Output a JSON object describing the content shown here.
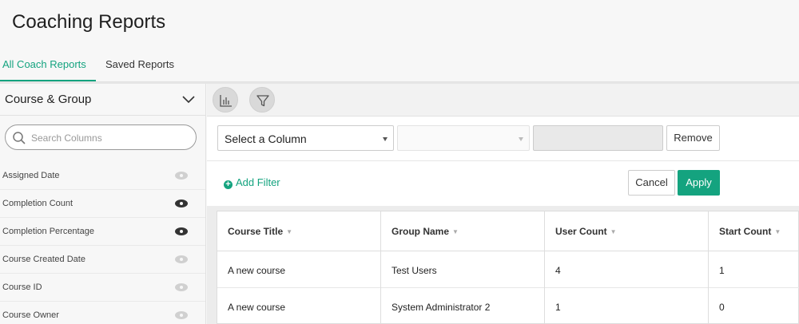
{
  "page": {
    "title": "Coaching Reports"
  },
  "tabs": [
    {
      "label": "All Coach Reports",
      "active": true
    },
    {
      "label": "Saved Reports",
      "active": false
    }
  ],
  "sidebar": {
    "header": "Course & Group",
    "search_placeholder": "Search Columns",
    "columns": [
      {
        "label": "Assigned Date",
        "visible": false
      },
      {
        "label": "Completion Count",
        "visible": true
      },
      {
        "label": "Completion Percentage",
        "visible": true
      },
      {
        "label": "Course Created Date",
        "visible": false
      },
      {
        "label": "Course ID",
        "visible": false
      },
      {
        "label": "Course Owner",
        "visible": false
      }
    ]
  },
  "toolbar": {
    "chart_icon": "bar-chart-icon",
    "filter_icon": "filter-icon"
  },
  "filter": {
    "column_select": "Select a Column",
    "operator_select": "",
    "value": "",
    "remove_label": "Remove",
    "add_filter_label": "Add Filter",
    "cancel_label": "Cancel",
    "apply_label": "Apply"
  },
  "table": {
    "headers": [
      "Course Title",
      "Group Name",
      "User Count",
      "Start Count"
    ],
    "rows": [
      [
        "A new course",
        "Test Users",
        "4",
        "1"
      ],
      [
        "A new course",
        "System Administrator 2",
        "1",
        "0"
      ]
    ]
  },
  "colors": {
    "accent": "#14a37f"
  }
}
